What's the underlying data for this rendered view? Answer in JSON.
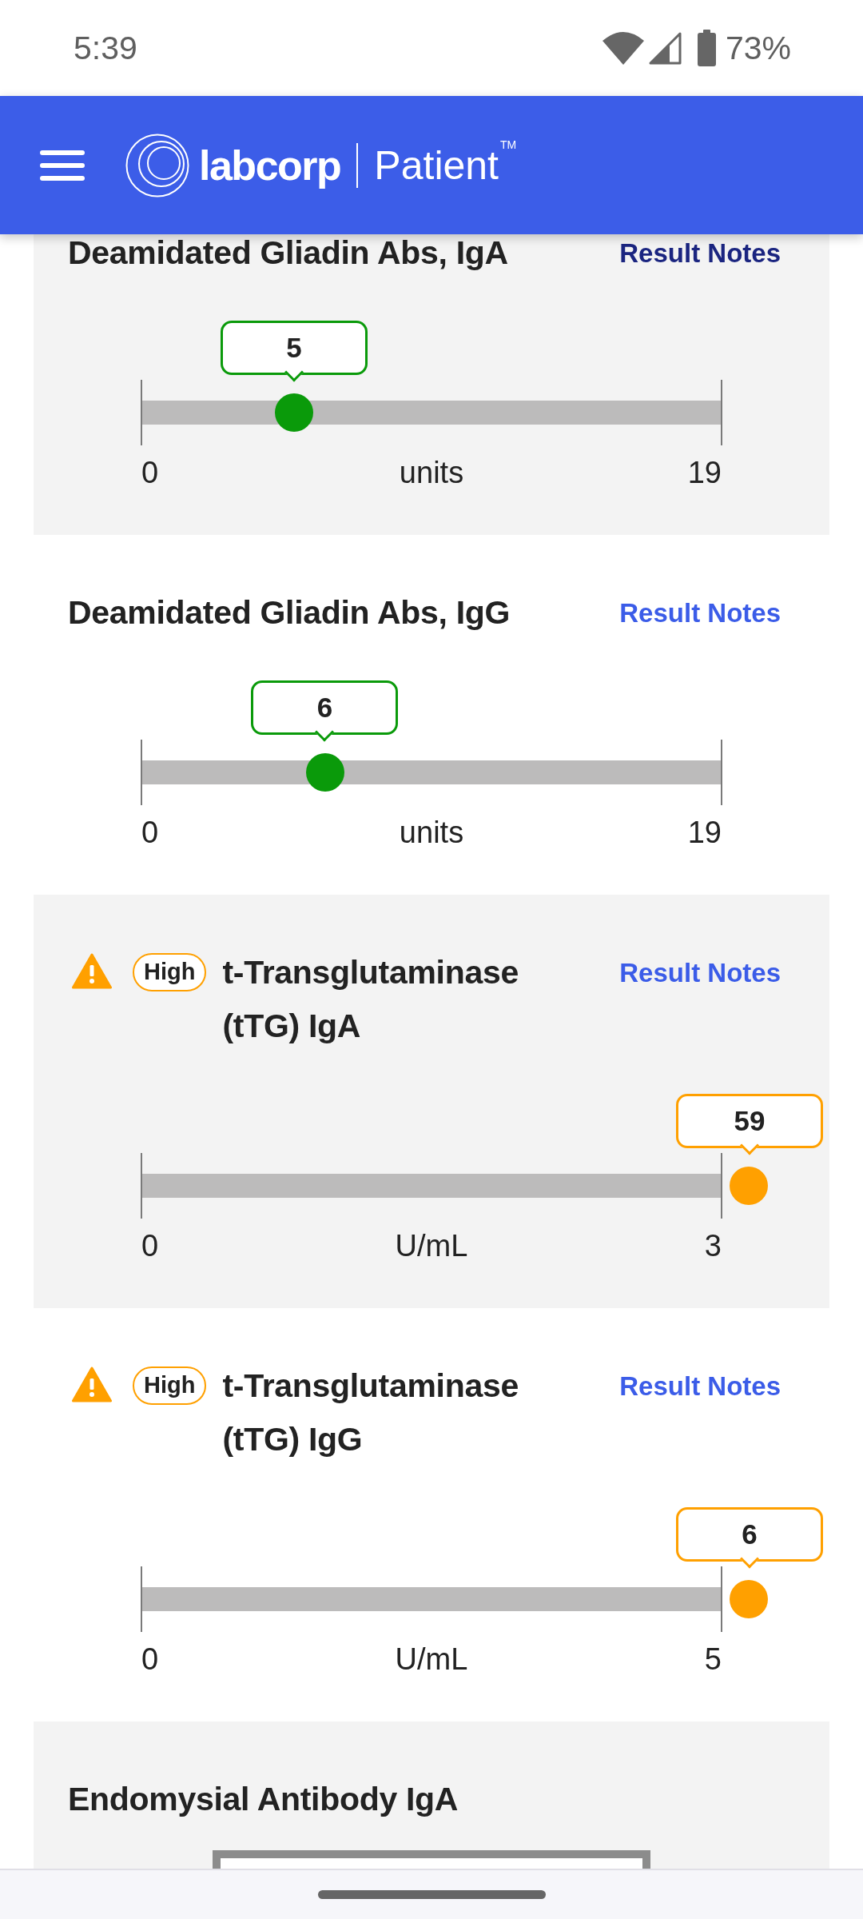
{
  "status_bar": {
    "time": "5:39",
    "battery": "73%"
  },
  "header": {
    "brand": "labcorp",
    "product": "Patient",
    "trademark": "TM"
  },
  "results": [
    {
      "kind": "range",
      "name": "Deamidated Gliadin Abs, IgA",
      "link": {
        "label": "Result Notes",
        "visited": true
      },
      "high": false,
      "value": "5",
      "level": 0.263,
      "min": "0",
      "unit": "units",
      "max": "19"
    },
    {
      "kind": "range",
      "name": "Deamidated Gliadin Abs, IgG",
      "link": {
        "label": "Result Notes",
        "visited": false
      },
      "high": false,
      "value": "6",
      "level": 0.316,
      "min": "0",
      "unit": "units",
      "max": "19"
    },
    {
      "kind": "range",
      "name": "t-Transglutaminase (tTG) IgA",
      "badge": "High",
      "link": {
        "label": "Result Notes",
        "visited": false
      },
      "high": true,
      "value": "59",
      "level": 1,
      "min": "0",
      "unit": "U/mL",
      "max": "3"
    },
    {
      "kind": "range",
      "name": "t-Transglutaminase (tTG) IgG",
      "badge": "High",
      "link": {
        "label": "Result Notes",
        "visited": false
      },
      "high": true,
      "value": "6",
      "level": 1,
      "min": "0",
      "unit": "U/mL",
      "max": "5"
    },
    {
      "kind": "box",
      "name": "Endomysial Antibody IgA"
    }
  ]
}
